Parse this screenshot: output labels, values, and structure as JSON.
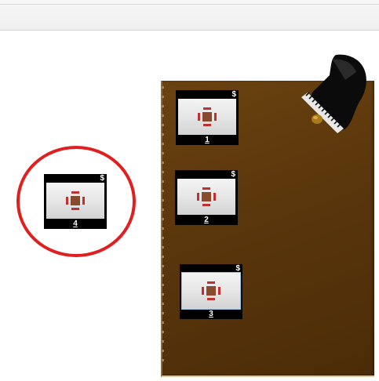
{
  "colors": {
    "board": "#5a360c",
    "highlight": "#e02020",
    "table_frame": "#000000"
  },
  "tables": [
    {
      "id": "table-1",
      "number": "1",
      "cost_symbol": "$"
    },
    {
      "id": "table-2",
      "number": "2",
      "cost_symbol": "$"
    },
    {
      "id": "table-3",
      "number": "3",
      "cost_symbol": "$"
    },
    {
      "id": "table-4",
      "number": "4",
      "cost_symbol": "$"
    }
  ],
  "icons": {
    "decoration": "grand-piano-icon",
    "table": "table-with-chairs-icon"
  }
}
